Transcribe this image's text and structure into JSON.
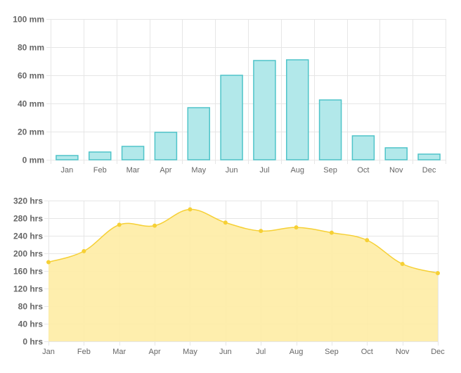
{
  "charts": [
    {
      "type": "bar",
      "categories": [
        "Jan",
        "Feb",
        "Mar",
        "Apr",
        "May",
        "Jun",
        "Jul",
        "Aug",
        "Sep",
        "Oct",
        "Nov",
        "Dec"
      ],
      "values": [
        3,
        5.5,
        9.5,
        19.5,
        37,
        60,
        70.5,
        71,
        42.5,
        17,
        8.5,
        4
      ],
      "ylim": [
        0,
        100
      ],
      "yticks": [
        "100 mm",
        "80 mm",
        "60 mm",
        "40 mm",
        "20 mm",
        "0 mm"
      ],
      "ytick_values": [
        100,
        80,
        60,
        40,
        20,
        0
      ],
      "colors": {
        "fill": "#b2e8ea",
        "stroke": "#4fc4c9",
        "grid": "#e6e6e6"
      }
    },
    {
      "type": "area",
      "categories": [
        "Jan",
        "Feb",
        "Mar",
        "Apr",
        "May",
        "Jun",
        "Jul",
        "Aug",
        "Sep",
        "Oct",
        "Nov",
        "Dec"
      ],
      "values": [
        180,
        205,
        265,
        263,
        300,
        270,
        251,
        259,
        247,
        230,
        176,
        155
      ],
      "ylim": [
        0,
        320
      ],
      "yticks": [
        "320 hrs",
        "280 hrs",
        "240 hrs",
        "200 hrs",
        "160 hrs",
        "120 hrs",
        "80 hrs",
        "40 hrs",
        "0 hrs"
      ],
      "ytick_values": [
        320,
        280,
        240,
        200,
        160,
        120,
        80,
        40,
        0
      ],
      "colors": {
        "fill": "#feeca4",
        "stroke": "#f6d035",
        "grid": "#e6e6e6"
      }
    }
  ]
}
